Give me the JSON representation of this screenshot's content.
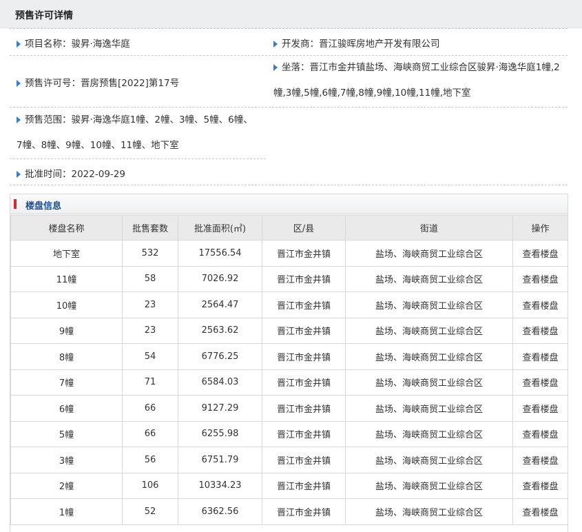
{
  "page": {
    "title": "预售许可详情"
  },
  "details": {
    "project_name": "项目名称：骏昇·海逸华庭",
    "developer": "开发商：晋江骏晖房地产开发有限公司",
    "permit_no": "预售许可号：晋房预售[2022]第17号",
    "location": "坐落：晋江市金井镇盐场、海峡商贸工业综合区骏昇·海逸华庭1幢,2幢,3幢,5幢,6幢,7幢,8幢,9幢,10幢,11幢,地下室",
    "presale_scope": "预售范围：骏昇·海逸华庭1幢、2幢、3幢、5幢、6幢、7幢、8幢、9幢、10幢、11幢、地下室",
    "approval_time": "批准时间：2022-09-29"
  },
  "buildings": {
    "section_title": "楼盘信息",
    "columns": [
      "楼盘名称",
      "批售套数",
      "批准面积(㎡)",
      "区/县",
      "街道",
      "操作"
    ],
    "rows": [
      [
        "地下室",
        "532",
        "17556.54",
        "晋江市金井镇",
        "盐场、海峡商贸工业综合区",
        "查看楼盘"
      ],
      [
        "11幢",
        "58",
        "7026.92",
        "晋江市金井镇",
        "盐场、海峡商贸工业综合区",
        "查看楼盘"
      ],
      [
        "10幢",
        "23",
        "2564.47",
        "晋江市金井镇",
        "盐场、海峡商贸工业综合区",
        "查看楼盘"
      ],
      [
        "9幢",
        "23",
        "2563.62",
        "晋江市金井镇",
        "盐场、海峡商贸工业综合区",
        "查看楼盘"
      ],
      [
        "8幢",
        "54",
        "6776.25",
        "晋江市金井镇",
        "盐场、海峡商贸工业综合区",
        "查看楼盘"
      ],
      [
        "7幢",
        "71",
        "6584.03",
        "晋江市金井镇",
        "盐场、海峡商贸工业综合区",
        "查看楼盘"
      ],
      [
        "6幢",
        "66",
        "9127.29",
        "晋江市金井镇",
        "盐场、海峡商贸工业综合区",
        "查看楼盘"
      ],
      [
        "5幢",
        "66",
        "6255.98",
        "晋江市金井镇",
        "盐场、海峡商贸工业综合区",
        "查看楼盘"
      ],
      [
        "3幢",
        "56",
        "6751.79",
        "晋江市金井镇",
        "盐场、海峡商贸工业综合区",
        "查看楼盘"
      ],
      [
        "2幢",
        "106",
        "10334.23",
        "晋江市金井镇",
        "盐场、海峡商贸工业综合区",
        "查看楼盘"
      ],
      [
        "1幢",
        "52",
        "6362.56",
        "晋江市金井镇",
        "盐场、海峡商贸工业综合区",
        "查看楼盘"
      ]
    ]
  }
}
